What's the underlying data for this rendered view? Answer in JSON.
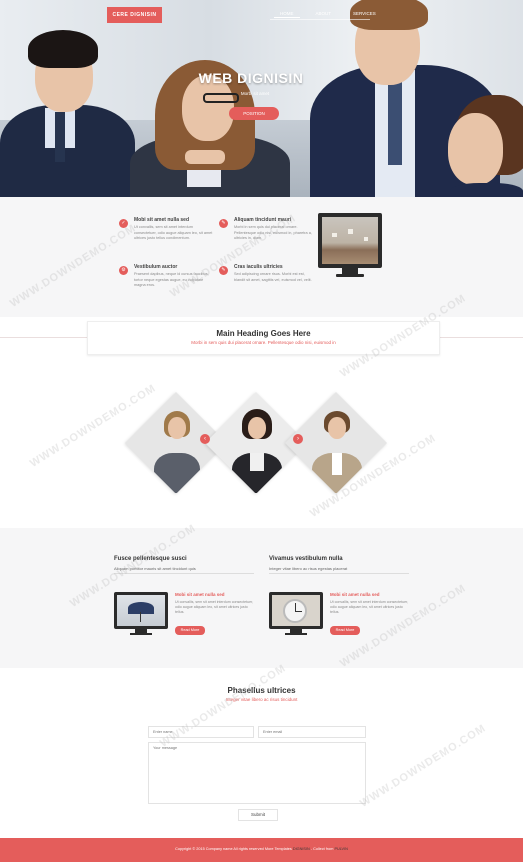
{
  "header": {
    "logo": "CERE DIGNISIN",
    "nav": [
      "HOME",
      "ABOUT",
      "SERVICES"
    ],
    "title": "WEB DIGNISIN",
    "subtitle": "Morbi sit amet",
    "cta": "POSITION"
  },
  "features": [
    {
      "title": "Mobi sit amet nulla sed",
      "text": "Ut convallis, sem sit amet interdum consectetuer, odio augue aliquam leo, sit amet ultrices justo tellus condimentum."
    },
    {
      "title": "Aliquam tincidunt mauri",
      "text": "Morbi in sem quis dui placerat ornare. Pellentesque odio nisi, euismod in, pharetra a, ultricies in, diam."
    },
    {
      "title": "Vestibulum auctor",
      "text": "Praesent dapibus, neque id cursus faucibus, tortor neque egestas augue, eu vulputate magna eros."
    },
    {
      "title": "Cras iaculis ultricies",
      "text": "Sed adipiscing ornare risus. Morbi est est, blandit sit amet, sagittis vel, euismod vel, velit."
    }
  ],
  "banner": {
    "heading": "Main Heading Goes Here",
    "sub": "Morbi in sem quis dui placerat ornare. Pellentesque odio nisi, euismod in"
  },
  "columns": [
    {
      "heading": "Fusce pellentesque susci",
      "sub": "Aliquam porttitor mauris sit amet tincidunt quis",
      "card_title": "Mobi sit amet nulla sed",
      "card_text": "Ut convallis, sem sit amet interdum consectetuer, odio augue aliquam leo, sit amet ultrices justo tellus.",
      "button": "Read More"
    },
    {
      "heading": "Vivamus vestibulum nulla",
      "sub": "Integer vitae libero ac risus egestas placerat",
      "card_title": "Mobi sit amet nulla sed",
      "card_text": "Ut convallis, sem sit amet interdum consectetuer, odio augue aliquam leo, sit amet ultrices justo tellus.",
      "button": "Read More"
    }
  ],
  "contact": {
    "heading": "Phasellus ultrices",
    "sub": "Integer vitae libero ac risus tincidunt",
    "name_placeholder": "Enter name",
    "email_placeholder": "Enter email",
    "message_placeholder": "Your message",
    "submit": "Submit"
  },
  "footer": {
    "copyright": "Copyright © 2015 Company name All rights reserved More Templates",
    "link1": "DIGNISIN",
    "mid": "- Collect from",
    "link2": "PULVIN"
  },
  "watermark": "WWW.DOWNDEMO.COM",
  "colors": {
    "accent": "#e45d5b",
    "dark": "#2b2b2b",
    "light_bg": "#f6f6f7"
  }
}
